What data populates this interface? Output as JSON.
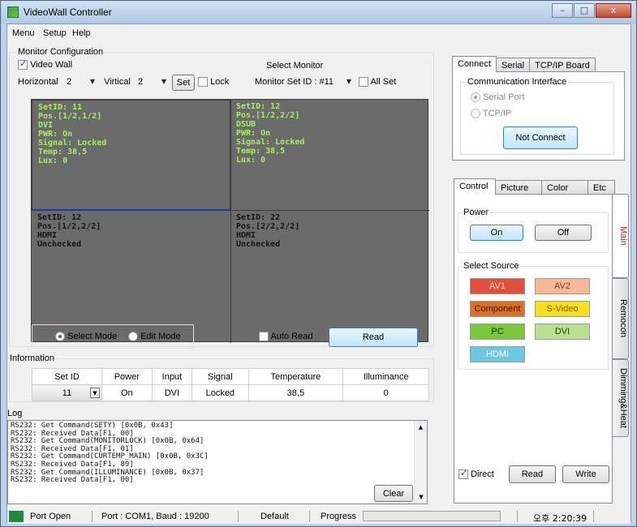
{
  "window": {
    "title": "VideoWall Controller",
    "minimize": "–",
    "maximize": "□",
    "close": "x"
  },
  "menu": [
    "Menu",
    "Setup",
    "Help"
  ],
  "monitor_config": {
    "legend": "Monitor Configuration",
    "video_wall_label": "Video Wall",
    "video_wall_checked": true,
    "horizontal_label": "Horizontal",
    "horizontal_value": "2",
    "vertical_label": "Virtical",
    "vertical_value": "2",
    "set_label": "Set",
    "lock_label": "Lock",
    "select_monitor_label": "Select Monitor",
    "monitor_set_value": "Monitor Set ID : #11",
    "all_set_label": "All Set"
  },
  "monitors": [
    {
      "lines": [
        "SetID: 11",
        "Pos.[1/2,1/2]",
        "DVI",
        "PWR: On",
        "Signal: Locked",
        "Temp: 38,5",
        "Lux: 0"
      ],
      "color": "#a8ee60"
    },
    {
      "lines": [
        "SetID: 12",
        "Pos.[1/2,2/2]",
        "DSUB",
        "PWR: On",
        "Signal: Locked",
        "Temp: 38,5",
        "Lux: 0"
      ],
      "color": "#a8ee60"
    },
    {
      "lines": [
        "SetID: 12",
        "Pos.[1/2,2/2]",
        "HDMI",
        "Unchecked"
      ],
      "color": "#141414"
    },
    {
      "lines": [
        "SetID: 22",
        "Pos.[2/2,2/2]",
        "HDMI",
        "Unchecked"
      ],
      "color": "#141414"
    }
  ],
  "mode": {
    "select_label": "Select Mode",
    "edit_label": "Edit Mode",
    "auto_read_label": "Auto Read",
    "read_label": "Read"
  },
  "information": {
    "legend": "Information",
    "headers": [
      "Set ID",
      "Power",
      "Input",
      "Signal",
      "Temperature",
      "Illuminance"
    ],
    "row": [
      "11",
      "On",
      "DVI",
      "Locked",
      "38,5",
      "0"
    ]
  },
  "log": {
    "legend": "Log",
    "lines": [
      "RS232: Get Command(SETY) [0x0B, 0x43]",
      "RS232: Received Data[F1, 00]",
      "RS232: Get Command(MONITORLOCK) [0x0B, 0x64]",
      "RS232: Received Data[F1, 01]",
      "RS232: Get Command(CURTEMP_MAIN) [0x0B, 0x3C]",
      "RS232: Received Data[F1, 89]",
      "RS232: Get Command(ILLUMINANCE) [0x0B, 0x37]",
      "RS232: Received Data[F1, 00]"
    ],
    "clear_label": "Clear"
  },
  "connect": {
    "tabs": [
      "Connect",
      "Serial",
      "TCP/IP Board"
    ],
    "legend": "Communication Interface",
    "serial_label": "Serial Port",
    "tcpip_label": "TCP/IP",
    "button_label": "Not Connect"
  },
  "control": {
    "tabs": [
      "Control",
      "Picture",
      "Color",
      "Etc"
    ],
    "side_tabs": [
      "Main",
      "Remocon",
      "Dimming&Heat"
    ],
    "power_legend": "Power",
    "on_label": "On",
    "off_label": "Off",
    "source_legend": "Select Source",
    "sources": [
      {
        "label": "AV1",
        "bg": "#e0503a",
        "fg": "#f8e0d8"
      },
      {
        "label": "AV2",
        "bg": "#f8b898",
        "fg": "#7a3a20"
      },
      {
        "label": "Component",
        "bg": "#d8702a",
        "fg": "#3a1a08"
      },
      {
        "label": "S-Video",
        "bg": "#f6e020",
        "fg": "#a05010"
      },
      {
        "label": "PC",
        "bg": "#7ac83a",
        "fg": "#1a3a08"
      },
      {
        "label": "DVI",
        "bg": "#b8e090",
        "fg": "#1a3a08"
      },
      {
        "label": "HDMI",
        "bg": "#6cc8e0",
        "fg": "#ffffff"
      }
    ],
    "direct_label": "Direct",
    "read_label": "Read",
    "write_label": "Write"
  },
  "status": {
    "port_open": "Port Open",
    "port_info": "Port : COM1,  Baud : 19200",
    "default": "Default",
    "progress_label": "Progress",
    "progress": 0,
    "time": "오후 2:20:39"
  }
}
